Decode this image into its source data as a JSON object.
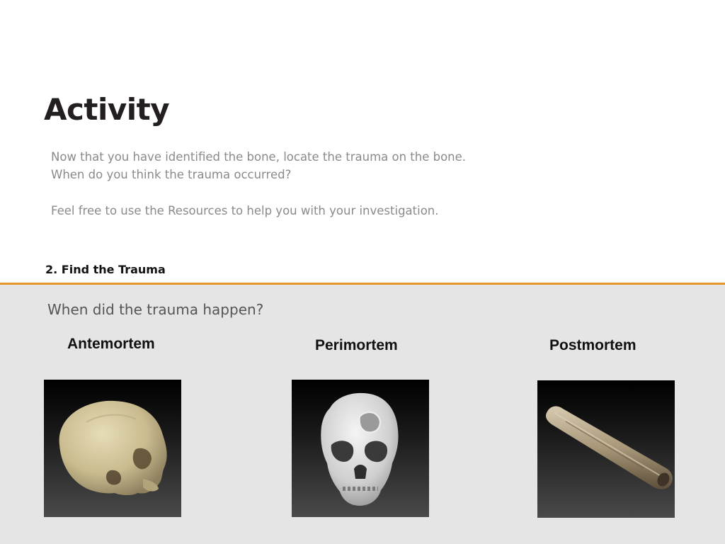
{
  "page": {
    "title": "Activity",
    "instructions": {
      "line1": "Now that you have identified the bone, locate the trauma on the bone.",
      "line2": "When do you think the trauma occurred?",
      "line3": "Feel free to use the Resources to help you with your investigation."
    },
    "step_label": "2. Find the Trauma"
  },
  "quiz": {
    "question": "When did the trauma happen?",
    "options": [
      {
        "label": "Antemortem",
        "image": "lateral-skull-image"
      },
      {
        "label": "Perimortem",
        "image": "frontal-skull-with-fracture-image"
      },
      {
        "label": "Postmortem",
        "image": "long-bone-image"
      }
    ]
  },
  "colors": {
    "accent": "#e7952f",
    "panel_background": "#e5e5e5",
    "title": "#231f20",
    "body_text": "#8a8a8a"
  }
}
